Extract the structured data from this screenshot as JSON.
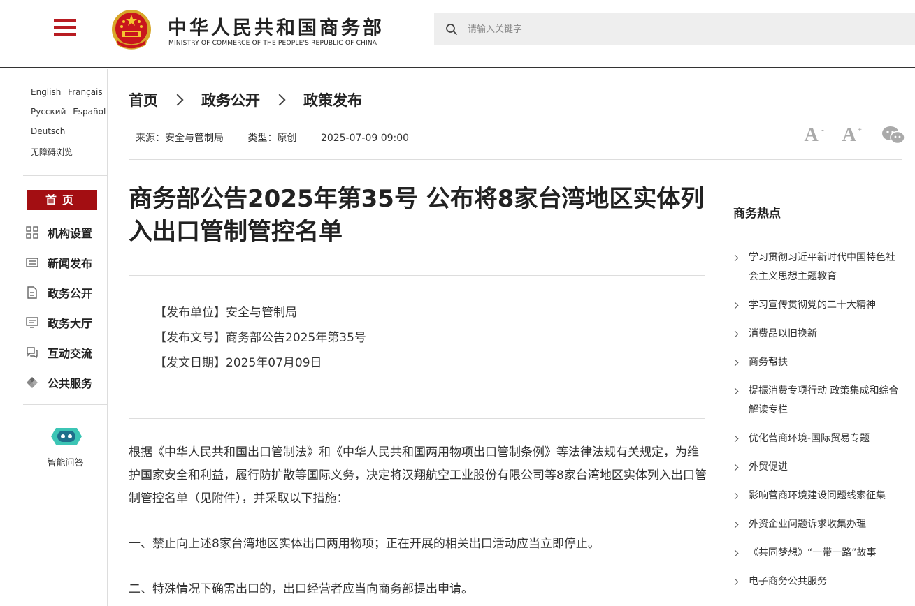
{
  "header": {
    "title_cn": "中华人民共和国商务部",
    "title_en": "MINISTRY OF COMMERCE OF THE PEOPLE'S REPUBLIC OF CHINA",
    "search_placeholder": "请输入关键字",
    "brand_color": "#b81c22"
  },
  "sidebar": {
    "languages": [
      [
        "English",
        "Français"
      ],
      [
        "Русский",
        "Español"
      ],
      [
        "Deutsch"
      ],
      [
        "无障碍浏览"
      ]
    ],
    "home": "首页",
    "nav": [
      {
        "label": "机构设置",
        "icon": "org-icon"
      },
      {
        "label": "新闻发布",
        "icon": "news-icon"
      },
      {
        "label": "政务公开",
        "icon": "document-icon"
      },
      {
        "label": "政务大厅",
        "icon": "service-hall-icon"
      },
      {
        "label": "互动交流",
        "icon": "chat-icon"
      },
      {
        "label": "公共服务",
        "icon": "public-service-icon"
      }
    ],
    "assistant_label": "智能问答"
  },
  "breadcrumb": [
    "首页",
    "政务公开",
    "政策发布"
  ],
  "meta": {
    "source": "来源：安全与管制局",
    "type": "类型：原创",
    "date": "2025-07-09 09:00"
  },
  "tools": {
    "font_smaller": "A",
    "font_smaller_mark": "-",
    "font_larger": "A",
    "font_larger_mark": "+",
    "share_icon": "wechat-icon"
  },
  "article": {
    "title": "商务部公告2025年第35号 公布将8家台湾地区实体列入出口管制管控名单",
    "info": [
      "【发布单位】安全与管制局",
      "【发布文号】商务部公告2025年第35号",
      "【发文日期】2025年07月09日"
    ],
    "paragraphs": [
      "根据《中华人民共和国出口管制法》和《中华人民共和国两用物项出口管制条例》等法律法规有关规定，为维护国家安全和利益，履行防扩散等国际义务，决定将汉翔航空工业股份有限公司等8家台湾地区实体列入出口管制管控名单（见附件），并采取以下措施：",
      "一、禁止向上述8家台湾地区实体出口两用物项；正在开展的相关出口活动应当立即停止。",
      "二、特殊情况下确需出口的，出口经营者应当向商务部提出申请。"
    ]
  },
  "hot": {
    "title": "商务热点",
    "items": [
      "学习贯彻习近平新时代中国特色社会主义思想主题教育",
      "学习宣传贯彻党的二十大精神",
      "消费品以旧换新",
      "商务帮扶",
      "提振消费专项行动 政策集成和综合解读专栏",
      "优化营商环境-国际贸易专题",
      "外贸促进",
      "影响营商环境建设问题线索征集",
      "外资企业问题诉求收集办理",
      "《共同梦想》“一带一路”故事",
      "电子商务公共服务"
    ]
  }
}
